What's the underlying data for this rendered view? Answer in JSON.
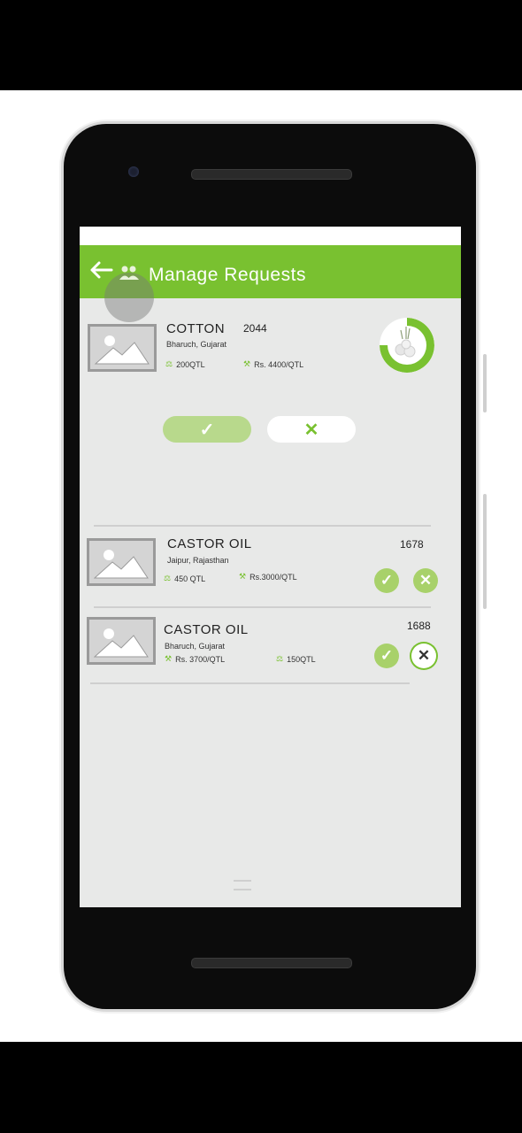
{
  "appbar": {
    "title": "Manage Requests",
    "back_icon": "arrow-left-icon",
    "people_icon": "group-icon"
  },
  "expanded_request": {
    "crop": "COTTON",
    "id": "2044",
    "location": "Bharuch, Gujarat",
    "quantity": "200QTL",
    "price": "Rs. 4400/QTL",
    "accept_glyph": "✓",
    "reject_glyph": "✕"
  },
  "requests": [
    {
      "crop": "CASTOR OIL",
      "id": "1678",
      "location": "Jaipur, Rajasthan",
      "quantity": "450 QTL",
      "price": "Rs.3000/QTL"
    },
    {
      "crop": "CASTOR OIL",
      "id": "1688",
      "location": "Bharuch, Gujarat",
      "price": "Rs. 3700/QTL",
      "quantity": "150QTL"
    }
  ],
  "colors": {
    "accent": "#79c130",
    "accent_light": "#a8d16a",
    "background": "#e8e9e8"
  }
}
